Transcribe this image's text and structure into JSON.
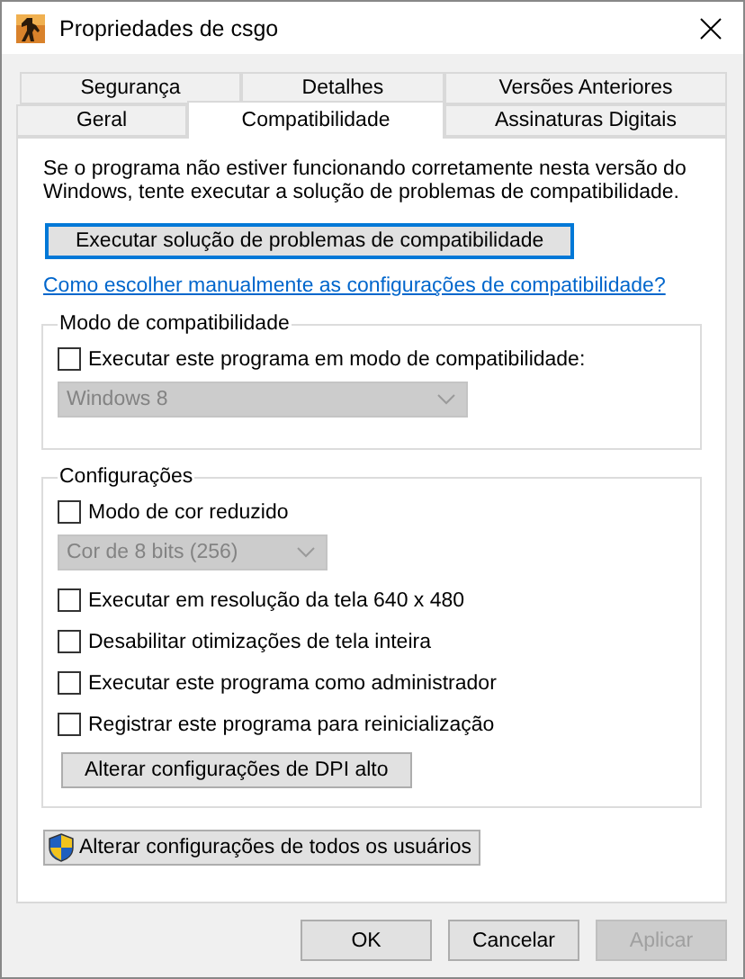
{
  "window": {
    "title": "Propriedades de csgo"
  },
  "tab_rows": [
    [
      {
        "label": "Segurança",
        "selected": false
      },
      {
        "label": "Detalhes",
        "selected": false
      },
      {
        "label": "Versões Anteriores",
        "selected": false
      }
    ],
    [
      {
        "label": "Geral",
        "selected": false
      },
      {
        "label": "Compatibilidade",
        "selected": true
      },
      {
        "label": "Assinaturas Digitais",
        "selected": false
      }
    ]
  ],
  "intro": "Se o programa não estiver funcionando corretamente nesta versão do Windows, tente executar a solução de problemas de compatibilidade.",
  "troubleshoot_button": {
    "label": "Executar solução de problemas de compatibilidade",
    "focused": true
  },
  "help_link": "Como escolher manualmente as configurações de compatibilidade?",
  "groups": [
    {
      "legend": "Modo de compatibilidade",
      "items": [
        {
          "kind": "checkbox",
          "label": "Executar este programa em modo de compatibilidade:",
          "checked": false
        },
        {
          "kind": "dropdown",
          "value": "Windows 8",
          "disabled": true
        }
      ]
    },
    {
      "legend": "Configurações",
      "items": [
        {
          "kind": "checkbox",
          "label": "Modo de cor reduzido",
          "checked": false
        },
        {
          "kind": "dropdown",
          "value": "Cor de 8 bits (256)",
          "disabled": true
        },
        {
          "kind": "checkbox",
          "label": "Executar em resolução da tela 640 x 480",
          "checked": false
        },
        {
          "kind": "checkbox",
          "label": "Desabilitar otimizações de tela inteira",
          "checked": false
        },
        {
          "kind": "checkbox",
          "label": "Executar este programa como administrador",
          "checked": false
        },
        {
          "kind": "checkbox",
          "label": "Registrar este programa para reinicialização",
          "checked": false
        },
        {
          "kind": "button",
          "label": "Alterar configurações de DPI alto"
        }
      ]
    }
  ],
  "all_users_button": {
    "label": "Alterar configurações de todos os usuários"
  },
  "buttons": [
    {
      "label": "OK",
      "disabled": false
    },
    {
      "label": "Cancelar",
      "disabled": false
    },
    {
      "label": "Aplicar",
      "disabled": true
    }
  ]
}
